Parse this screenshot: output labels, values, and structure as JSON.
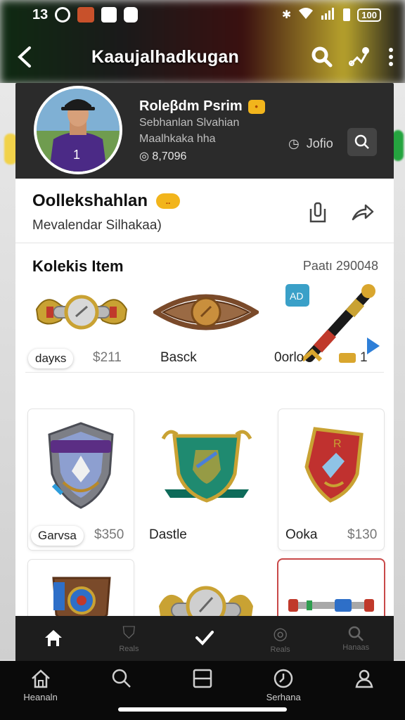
{
  "status_bar": {
    "time": "13",
    "battery": "100",
    "signal_icon": "signal-bars-icon",
    "wifi_icon": "wifi-icon",
    "bluetooth_icon": "bluetooth-icon"
  },
  "app_bar": {
    "title": "Kaaujalhadkugan",
    "back_icon": "back-arrow-icon",
    "search_icon": "search-icon",
    "share_icon": "share-icon",
    "more_icon": "more-vertical-icon"
  },
  "profile": {
    "name": "Roleβdm Psrim",
    "line1": "Sebhanlan Slvahian",
    "line2": "Maalhkaka hha",
    "stat": "8,7096",
    "info_label": "Jofio",
    "name_badge_icon": "verified-badge-icon"
  },
  "collection": {
    "title": "Oollekshahlan",
    "badge_text": "..",
    "subtitle": "Mevalendar Silhakaa)",
    "bookmark_icon": "bookmark-icon",
    "share_icon": "share-arrow-icon"
  },
  "items_section": {
    "title": "Kolekis Item",
    "count_label": "Paatı 290048"
  },
  "row1": [
    {
      "pill": "dayĸs",
      "price": "$211",
      "icon": "winged-silver-badge-icon"
    },
    {
      "label": "Basck",
      "icon": "bronze-eye-amulet-icon"
    },
    {
      "label": "0orlo",
      "price": "1",
      "icon": "golden-scepter-icon"
    }
  ],
  "grid": [
    {
      "pill": "Garvsa",
      "price": "$350",
      "icon": "purple-shield-crest-icon"
    },
    {
      "label": "Dastle",
      "icon": "green-gold-emblem-icon"
    },
    {
      "label": "Ooka",
      "price": "$130",
      "icon": "red-shield-emblem-icon"
    },
    {
      "icon": "blue-red-shield-icon"
    },
    {
      "icon": "silver-winged-medal-icon"
    },
    {
      "icon": "metal-rod-icon"
    }
  ],
  "inner_nav": [
    {
      "label": "",
      "icon": "home-icon",
      "active": true
    },
    {
      "label": "Reals",
      "icon": "cart-icon",
      "active": false
    },
    {
      "label": "",
      "icon": "check-icon",
      "active": true
    },
    {
      "label": "Reals",
      "icon": "medal-icon",
      "active": false
    },
    {
      "label": "Hanaas",
      "icon": "search-icon",
      "active": false
    }
  ],
  "bottom_nav": [
    {
      "label": "Heanaln",
      "icon": "home-outline-icon"
    },
    {
      "label": "",
      "icon": "search-outline-icon"
    },
    {
      "label": "",
      "icon": "window-icon"
    },
    {
      "label": "Serhana",
      "icon": "clock-icon"
    },
    {
      "label": "",
      "icon": "profile-icon"
    }
  ],
  "colors": {
    "accent_yellow": "#f2b51c",
    "profile_bg": "#2b2b2b",
    "nav_bg": "#0a0a0a",
    "selected_border": "#c84848"
  }
}
